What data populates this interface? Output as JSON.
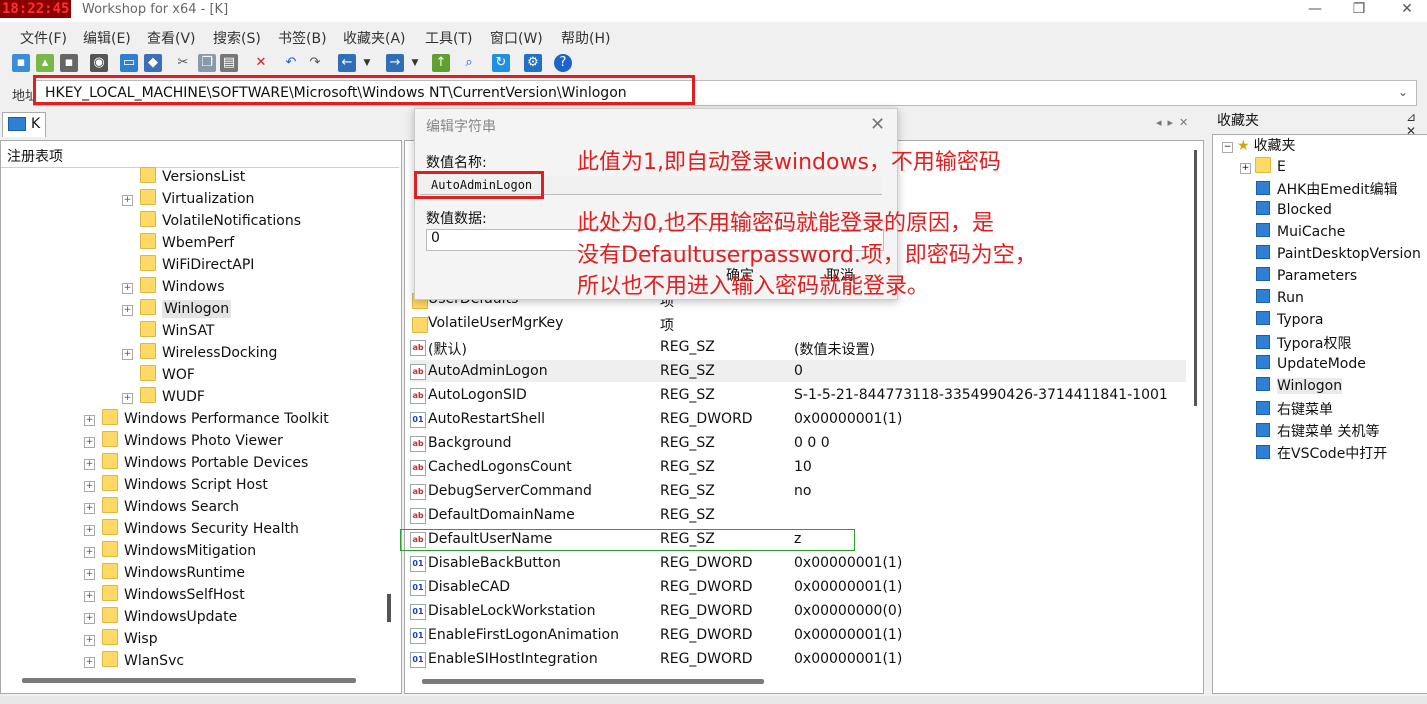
{
  "window": {
    "clock": "18:22:45",
    "title": "Workshop for x64 - [K]",
    "minimize": "—",
    "restore": "❐",
    "close": "✕"
  },
  "menu": [
    "文件(F)",
    "编辑(E)",
    "查看(V)",
    "搜索(S)",
    "书签(B)",
    "收藏夹(A)",
    "工具(T)",
    "窗口(W)",
    "帮助(H)"
  ],
  "address": {
    "label": "地址",
    "value": "HKEY_LOCAL_MACHINE\\SOFTWARE\\Microsoft\\Windows NT\\CurrentVersion\\Winlogon"
  },
  "left": {
    "tab": "K",
    "header": "注册表项",
    "tree": [
      {
        "label": "VersionsList",
        "expand": false
      },
      {
        "label": "Virtualization",
        "expand": true
      },
      {
        "label": "VolatileNotifications",
        "expand": false
      },
      {
        "label": "WbemPerf",
        "expand": false
      },
      {
        "label": "WiFiDirectAPI",
        "expand": false
      },
      {
        "label": "Windows",
        "expand": true
      },
      {
        "label": "Winlogon",
        "expand": true,
        "selected": true
      },
      {
        "label": "WinSAT",
        "expand": false
      },
      {
        "label": "WirelessDocking",
        "expand": true
      },
      {
        "label": "WOF",
        "expand": false
      },
      {
        "label": "WUDF",
        "expand": true
      },
      {
        "label": "Windows Performance Toolkit",
        "expand": true
      },
      {
        "label": "Windows Photo Viewer",
        "expand": true
      },
      {
        "label": "Windows Portable Devices",
        "expand": true
      },
      {
        "label": "Windows Script Host",
        "expand": true
      },
      {
        "label": "Windows Search",
        "expand": true
      },
      {
        "label": "Windows Security Health",
        "expand": true
      },
      {
        "label": "WindowsMitigation",
        "expand": true
      },
      {
        "label": "WindowsRuntime",
        "expand": true
      },
      {
        "label": "WindowsSelfHost",
        "expand": true
      },
      {
        "label": "WindowsUpdate",
        "expand": true
      },
      {
        "label": "Wisp",
        "expand": true
      },
      {
        "label": "WlanSvc",
        "expand": true
      }
    ]
  },
  "values": {
    "rows": [
      {
        "name": "UserDefaults",
        "type": "项",
        "data": "",
        "kind": "key"
      },
      {
        "name": "VolatileUserMgrKey",
        "type": "项",
        "data": "",
        "kind": "key"
      },
      {
        "name": "(默认)",
        "type": "REG_SZ",
        "data": "(数值未设置)",
        "kind": "sz"
      },
      {
        "name": "AutoAdminLogon",
        "type": "REG_SZ",
        "data": "0",
        "kind": "sz"
      },
      {
        "name": "AutoLogonSID",
        "type": "REG_SZ",
        "data": "S-1-5-21-844773118-3354990426-3714411841-1001",
        "kind": "sz"
      },
      {
        "name": "AutoRestartShell",
        "type": "REG_DWORD",
        "data": "0x00000001(1)",
        "kind": "dw"
      },
      {
        "name": "Background",
        "type": "REG_SZ",
        "data": "0 0 0",
        "kind": "sz"
      },
      {
        "name": "CachedLogonsCount",
        "type": "REG_SZ",
        "data": "10",
        "kind": "sz"
      },
      {
        "name": "DebugServerCommand",
        "type": "REG_SZ",
        "data": "no",
        "kind": "sz"
      },
      {
        "name": "DefaultDomainName",
        "type": "REG_SZ",
        "data": "",
        "kind": "sz"
      },
      {
        "name": "DefaultUserName",
        "type": "REG_SZ",
        "data": "z",
        "kind": "sz"
      },
      {
        "name": "DisableBackButton",
        "type": "REG_DWORD",
        "data": "0x00000001(1)",
        "kind": "dw"
      },
      {
        "name": "DisableCAD",
        "type": "REG_DWORD",
        "data": "0x00000001(1)",
        "kind": "dw"
      },
      {
        "name": "DisableLockWorkstation",
        "type": "REG_DWORD",
        "data": "0x00000000(0)",
        "kind": "dw"
      },
      {
        "name": "EnableFirstLogonAnimation",
        "type": "REG_DWORD",
        "data": "0x00000001(1)",
        "kind": "dw"
      },
      {
        "name": "EnableSIHostIntegration",
        "type": "REG_DWORD",
        "data": "0x00000001(1)",
        "kind": "dw"
      }
    ]
  },
  "dialog": {
    "title": "编辑字符串",
    "name_label": "数值名称:",
    "name_value": "AutoAdminLogon",
    "data_label": "数值数据:",
    "data_value": "0",
    "ok": "确定",
    "cancel": "取消"
  },
  "annotations": [
    "此值为1,即自动登录windows，不用输密码",
    "此处为0,也不用输密码就能登录的原因，是",
    "没有Defaultuserpassword.项，即密码为空，",
    "所以也不用进入输入密码就能登录。"
  ],
  "favorites": {
    "title": "收藏夹",
    "root": "收藏夹",
    "items": [
      "E",
      "AHK由Emedit编辑",
      "Blocked",
      "MuiCache",
      "PaintDesktopVersion",
      "Parameters",
      "Run",
      "Typora",
      "Typora权限",
      "UpdateMode",
      "Winlogon",
      "右键菜单",
      "右键菜单 关机等",
      "在VSCode中打开"
    ]
  },
  "colors": {
    "annotation_red": "#e02020",
    "highlight_green": "#2ca02c",
    "folder_yellow": "#ffd966"
  }
}
